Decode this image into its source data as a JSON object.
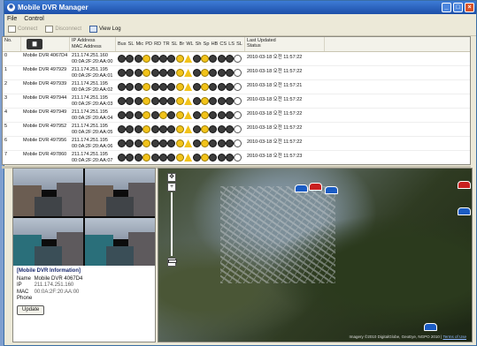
{
  "window": {
    "title": "Mobile DVR Manager",
    "minimize": "_",
    "maximize": "□",
    "close": "×"
  },
  "menu": [
    "File",
    "Control"
  ],
  "toolbar": {
    "btn1": "Connect",
    "btn2": "Disconnect",
    "btn3": "View Log"
  },
  "table": {
    "headers": {
      "no": "No.",
      "ip": "IP Address",
      "mac": "MAC Address",
      "last_updated": "Last Updated",
      "status": "Status"
    },
    "icon_headers": [
      "Bus",
      "SL",
      "Mic",
      "PD",
      "RD",
      "TR",
      "SL",
      "Br",
      "WL",
      "Sh",
      "Sp",
      "HB",
      "CS",
      "LS",
      "SL"
    ],
    "rows": [
      {
        "no": "0",
        "name": "Mobile DVR 4067D4",
        "ip": "211.174.251.160",
        "mac": "00:0A:2F:20:AA:00",
        "date": "2010-03-18 오전 11:57:22"
      },
      {
        "no": "1",
        "name": "Mobile DVR 497929",
        "ip": "211.174.251.195",
        "mac": "00:0A:2F:20:AA:01",
        "date": "2010-03-18 오전 11:57:22"
      },
      {
        "no": "2",
        "name": "Mobile DVR 497939",
        "ip": "211.174.251.195",
        "mac": "00:0A:2F:20:AA:02",
        "date": "2010-03-18 오전 11:57:21"
      },
      {
        "no": "3",
        "name": "Mobile DVR 497944",
        "ip": "211.174.251.195",
        "mac": "00:0A:2F:20:AA:03",
        "date": "2010-03-18 오전 11:57:22"
      },
      {
        "no": "4",
        "name": "Mobile DVR 497949",
        "ip": "211.174.251.195",
        "mac": "00:0A:2F:20:AA:04",
        "date": "2010-03-18 오전 11:57:22"
      },
      {
        "no": "5",
        "name": "Mobile DVR 497952",
        "ip": "211.174.251.195",
        "mac": "00:0A:2F:20:AA:05",
        "date": "2010-03-18 오전 11:57:22"
      },
      {
        "no": "6",
        "name": "Mobile DVR 497956",
        "ip": "211.174.251.195",
        "mac": "00:0A:2F:20:AA:06",
        "date": "2010-03-18 오전 11:57:22"
      },
      {
        "no": "7",
        "name": "Mobile DVR 497860",
        "ip": "211.174.251.195",
        "mac": "00:0A:2F:20:AA:07",
        "date": "2010-03-18 오전 11:57:23"
      }
    ]
  },
  "info": {
    "title": "[Mobile DVR Information]",
    "name_label": "Name",
    "name": "Mobile DVR 4067D4",
    "ip_label": "IP",
    "ip": "211.174.251.160",
    "mac_label": "MAC",
    "mac": "00:0A:2F:20:AA:00",
    "phone_label": "Phone",
    "phone": "",
    "update": "Update"
  },
  "map": {
    "credit": "Imagery ©2010 DigitalGlobe, GeoEye, NGPO 2010 | ",
    "terms": "Terms of Use"
  }
}
